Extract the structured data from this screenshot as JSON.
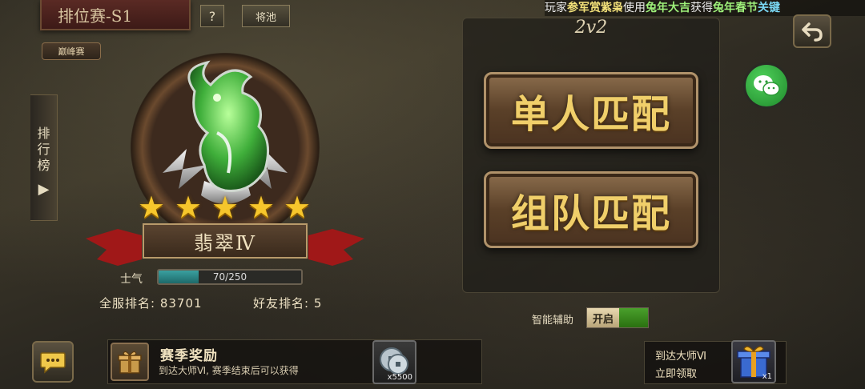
{
  "header": {
    "ranked_title": "排位赛-S1",
    "help_label": "?",
    "reward_label": "将池",
    "peak_label": "巅峰赛"
  },
  "marquee": {
    "part1": "玩家",
    "player": "参军赏紫枭",
    "part2": "使用",
    "item": "兔年大吉",
    "part3": "获得",
    "prize": "兔年春节",
    "part4": "关键"
  },
  "leaderboard": {
    "label_1": "排",
    "label_2": "行",
    "label_3": "榜",
    "arrow": "▶"
  },
  "rank": {
    "stars": 5,
    "tier": "翡翠Ⅳ",
    "morale_label": "士气",
    "morale_text": "70/250",
    "morale_fraction": 0.28,
    "server_rank": "全服排名: 83701",
    "friend_rank": "好友排名: 5"
  },
  "mode": {
    "title": "2v2",
    "solo_match": "单人匹配",
    "team_match": "组队匹配",
    "assist_label": "智能辅助",
    "assist_state": "开启"
  },
  "season": {
    "title": "赛季奖励",
    "desc": "到达大师Ⅵ, 赛季结束后可以获得",
    "coin_qty": "x5500"
  },
  "master": {
    "title": "到达大师Ⅵ",
    "claim": "立即领取",
    "gift_qty": "x1"
  },
  "icons": {
    "back": "back-arrow-icon",
    "wechat": "wechat-icon",
    "chat": "chat-bubble-icon",
    "gift": "gift-box-icon",
    "coin": "coin-icon",
    "dragon": "dragon-emblem-icon"
  },
  "colors": {
    "accent_gold": "#f0cf6a",
    "star": "#f6c62c",
    "toggle_on": "#4aa02c",
    "morale_fill": "#3aa0a0"
  }
}
